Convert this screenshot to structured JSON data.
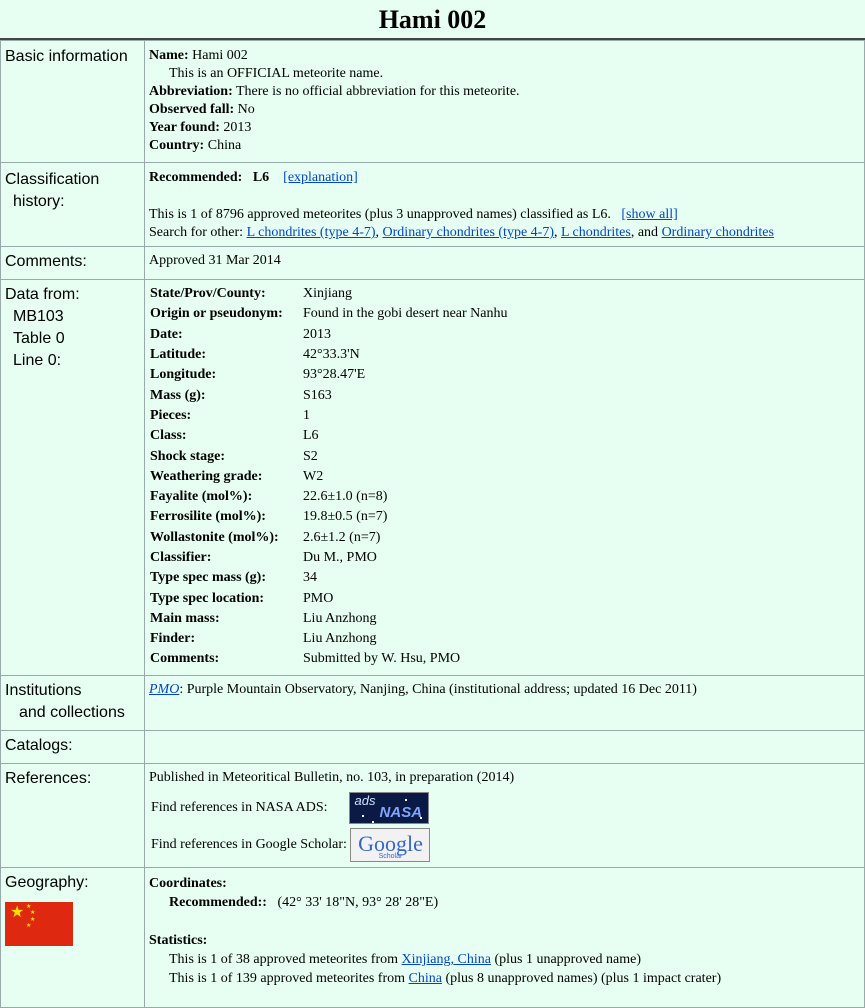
{
  "title": "Hami 002",
  "basic": {
    "label": "Basic information",
    "name_label": "Name:",
    "name": "Hami 002",
    "official_note": "This is an OFFICIAL meteorite name.",
    "abbr_label": "Abbreviation:",
    "abbr": "There is no official abbreviation for this meteorite.",
    "fall_label": "Observed fall:",
    "fall": "No",
    "year_label": "Year found:",
    "year": "2013",
    "country_label": "Country:",
    "country": "China"
  },
  "classification": {
    "label_line1": "Classification",
    "label_line2": "history:",
    "recommended_label": "Recommended:",
    "recommended": "L6",
    "explanation": "[explanation]",
    "count_text": "This is 1 of 8796 approved meteorites (plus 3 unapproved names) classified as L6.",
    "show_all": "[show all]",
    "search_prefix": "Search for other:",
    "link1": "L chondrites (type 4-7)",
    "link2": "Ordinary chondrites (type 4-7)",
    "link3": "L chondrites",
    "and_text": ", and",
    "link4": "Ordinary chondrites"
  },
  "comments": {
    "label": "Comments:",
    "value": "Approved 31 Mar 2014"
  },
  "data_from": {
    "label_line1": "Data from:",
    "label_line2": "MB103",
    "label_line3": "Table 0",
    "label_line4": "Line 0:",
    "rows": [
      {
        "k": "State/Prov/County:",
        "v": "Xinjiang"
      },
      {
        "k": "Origin or pseudonym:",
        "v": "Found in the gobi desert near Nanhu"
      },
      {
        "k": "Date:",
        "v": "2013"
      },
      {
        "k": "Latitude:",
        "v": "42°33.3'N"
      },
      {
        "k": "Longitude:",
        "v": "93°28.47'E"
      },
      {
        "k": "Mass (g):",
        "v": "S163"
      },
      {
        "k": "Pieces:",
        "v": "1"
      },
      {
        "k": "Class:",
        "v": "L6"
      },
      {
        "k": "Shock stage:",
        "v": "S2"
      },
      {
        "k": "Weathering grade:",
        "v": "W2"
      },
      {
        "k": "Fayalite (mol%):",
        "v": "22.6±1.0 (n=8)"
      },
      {
        "k": "Ferrosilite (mol%):",
        "v": "19.8±0.5 (n=7)"
      },
      {
        "k": "Wollastonite (mol%):",
        "v": "2.6±1.2 (n=7)"
      },
      {
        "k": "Classifier:",
        "v": "Du M., PMO"
      },
      {
        "k": "Type spec mass (g):",
        "v": "34"
      },
      {
        "k": "Type spec location:",
        "v": "PMO"
      },
      {
        "k": "Main mass:",
        "v": "Liu Anzhong"
      },
      {
        "k": "Finder:",
        "v": "Liu Anzhong"
      },
      {
        "k": "Comments:",
        "v": "Submitted by W. Hsu, PMO"
      }
    ]
  },
  "institutions": {
    "label_line1": "Institutions",
    "label_line2": "and collections",
    "link": "PMO",
    "text": ": Purple Mountain Observatory, Nanjing, China (institutional address; updated 16 Dec 2011)"
  },
  "catalogs": {
    "label": "Catalogs:"
  },
  "references": {
    "label": "References:",
    "published": "Published in Meteoritical Bulletin, no. 103, in preparation (2014)",
    "ads_text": "Find references in NASA ADS:",
    "ads_logo": "ads",
    "ads_logo_word": "NASA",
    "scholar_text": "Find references in Google Scholar:",
    "scholar_logo": "Google",
    "scholar_sub": "Scholar"
  },
  "geography": {
    "label": "Geography:",
    "coords_label": "Coordinates:",
    "recommended_label": "Recommended::",
    "recommended": "(42° 33' 18\"N, 93° 28' 28\"E)",
    "stats_label": "Statistics:",
    "stat1_pre": "This is 1 of 38 approved meteorites from",
    "stat1_link": "Xinjiang, China",
    "stat1_post": "(plus 1 unapproved name)",
    "stat2_pre": "This is 1 of 139 approved meteorites from",
    "stat2_link": "China",
    "stat2_post": "(plus 8 unapproved names) (plus 1 impact crater)"
  },
  "colors": {
    "background": "#e6fff2",
    "link": "#0044cc",
    "flag_red": "#de2910",
    "flag_yellow": "#ffde00"
  },
  "icons": {
    "flag": "china-flag-icon"
  }
}
